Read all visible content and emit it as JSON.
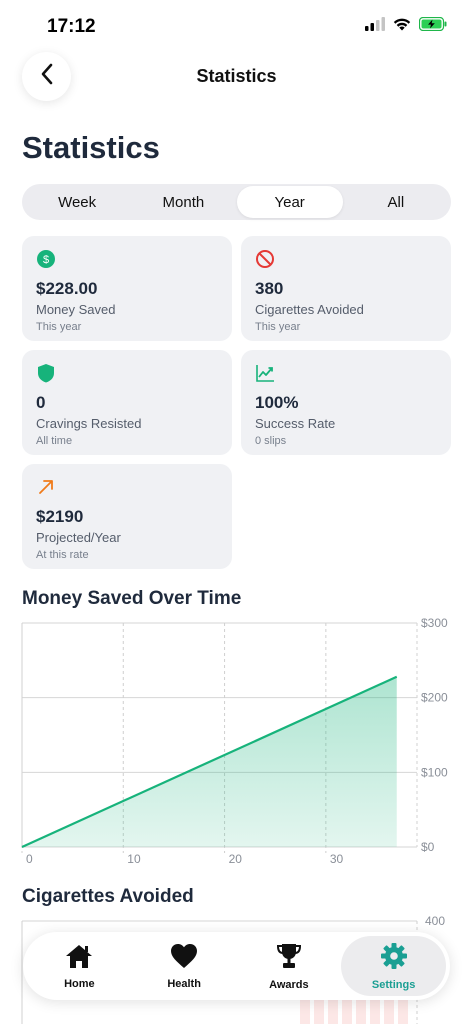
{
  "status_bar": {
    "time": "17:12",
    "battery_charging": true
  },
  "nav": {
    "title": "Statistics"
  },
  "page": {
    "title": "Statistics"
  },
  "segments": [
    {
      "label": "Week",
      "active": false
    },
    {
      "label": "Month",
      "active": false
    },
    {
      "label": "Year",
      "active": true
    },
    {
      "label": "All",
      "active": false
    }
  ],
  "stats": [
    {
      "icon": "dollar-circle-icon",
      "icon_color": "#17b37b",
      "value": "$228.00",
      "label": "Money Saved",
      "sub": "This year"
    },
    {
      "icon": "no-smoking-icon",
      "icon_color": "#e53935",
      "value": "380",
      "label": "Cigarettes Avoided",
      "sub": "This year"
    },
    {
      "icon": "shield-icon",
      "icon_color": "#17b37b",
      "value": "0",
      "label": "Cravings Resisted",
      "sub": "All time"
    },
    {
      "icon": "trending-up-icon",
      "icon_color": "#17b37b",
      "value": "100%",
      "label": "Success Rate",
      "sub": "0 slips"
    },
    {
      "icon": "arrow-up-right-icon",
      "icon_color": "#f07b1a",
      "value": "$2190",
      "label": "Projected/Year",
      "sub": "At this rate"
    }
  ],
  "charts": {
    "money_title": "Money Saved Over Time",
    "cigarettes_title": "Cigarettes Avoided"
  },
  "chart_data": [
    {
      "type": "area",
      "title": "Money Saved Over Time",
      "xlabel": "",
      "ylabel": "",
      "x_ticks": [
        0,
        10,
        20,
        30
      ],
      "y_ticks": [
        "$0",
        "$100",
        "$200",
        "$300"
      ],
      "xlim": [
        0,
        39
      ],
      "ylim": [
        0,
        300
      ],
      "grid": true,
      "color": "#17b37b",
      "points": [
        {
          "x": 0,
          "y": 0
        },
        {
          "x": 37,
          "y": 228
        }
      ]
    },
    {
      "type": "bar",
      "title": "Cigarettes Avoided",
      "y_ticks": [
        "400"
      ],
      "ylim": [
        0,
        400
      ],
      "grid": true,
      "color": "#e53935"
    }
  ],
  "tabs": [
    {
      "label": "Home",
      "icon": "home-icon",
      "active": false
    },
    {
      "label": "Health",
      "icon": "heart-icon",
      "active": false
    },
    {
      "label": "Awards",
      "icon": "trophy-icon",
      "active": false
    },
    {
      "label": "Settings",
      "icon": "gear-icon",
      "active": true
    }
  ],
  "colors": {
    "accent": "#1a9f93",
    "green": "#17b37b",
    "card_bg": "#f0f1f4"
  }
}
